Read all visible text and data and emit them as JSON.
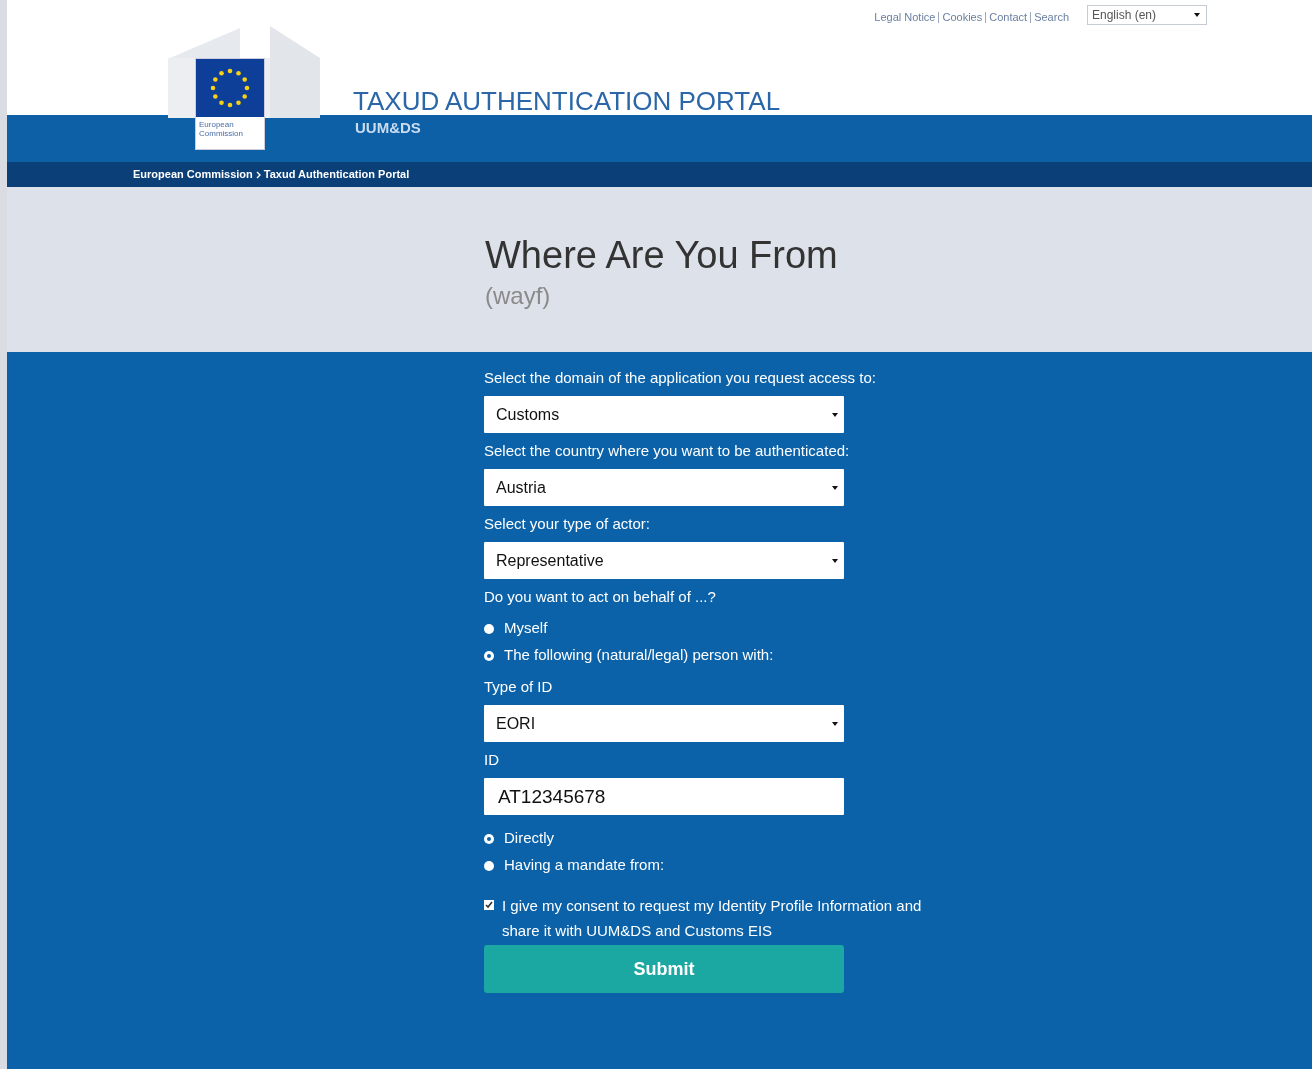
{
  "top_links": [
    {
      "label": "Legal Notice"
    },
    {
      "label": "Cookies"
    },
    {
      "label": "Contact"
    },
    {
      "label": "Search"
    }
  ],
  "language_select": {
    "value": "English (en)"
  },
  "header": {
    "logo_text": "European Commission",
    "title": "TAXUD AUTHENTICATION PORTAL",
    "subtitle": "UUM&DS"
  },
  "breadcrumb": [
    "European Commission",
    "Taxud Authentication Portal"
  ],
  "page": {
    "title": "Where Are You From",
    "subtitle": "(wayf)"
  },
  "form": [
    {
      "kind": "select",
      "label": "Select the domain of the application you request access to:",
      "value": "Customs"
    },
    {
      "kind": "select",
      "label": "Select the country where you want to be authenticated:",
      "value": "Austria"
    },
    {
      "kind": "select",
      "label": "Select your type of actor:",
      "value": "Representative"
    },
    {
      "kind": "radio",
      "label": "Do you want to act on behalf of ...?",
      "options": [
        {
          "label": "Myself",
          "selected": false
        },
        {
          "label": "The following (natural/legal) person with:",
          "selected": true
        }
      ]
    },
    {
      "kind": "select",
      "label": "Type of ID",
      "value": "EORI"
    },
    {
      "kind": "text",
      "label": "ID",
      "value": "AT12345678"
    },
    {
      "kind": "radio",
      "options": [
        {
          "label": "Directly",
          "selected": true
        },
        {
          "label": "Having a mandate from:",
          "selected": false
        }
      ]
    },
    {
      "kind": "checkbox",
      "label": "I give my consent to request my Identity Profile Information and share it with UUM&DS and Customs EIS",
      "checked": true
    },
    {
      "kind": "button",
      "label": "Submit"
    }
  ]
}
